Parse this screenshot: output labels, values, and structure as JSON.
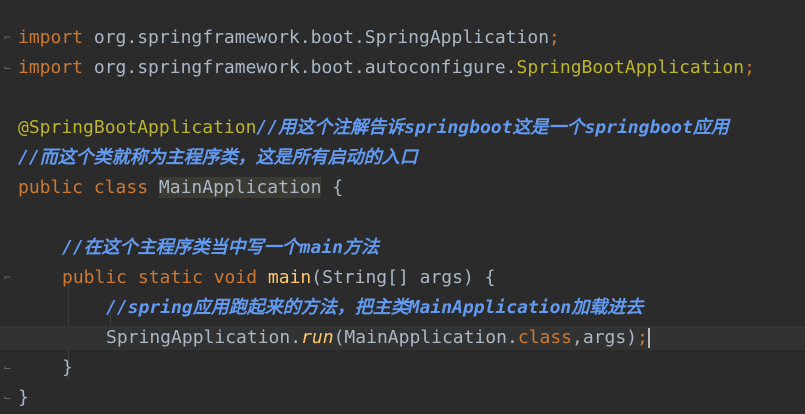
{
  "code": {
    "l1": {
      "kw": "import",
      "pkg": " org.springframework.boot.",
      "cls": "SpringApplication",
      "semi": ";"
    },
    "l2": {
      "kw": "import",
      "pkg": " org.springframework.boot.autoconfigure.",
      "cls": "SpringBootApplication",
      "semi": ";"
    },
    "l3": {
      "ann": "@SpringBootApplication",
      "cmt": "//用这个注解告诉springboot这是一个springboot应用"
    },
    "l4": {
      "cmt": "//而这个类就称为主程序类，这是所有启动的入口"
    },
    "l5": {
      "kw": "public class ",
      "cls": "MainApplication",
      "rest": " {"
    },
    "l6": {
      "cmt": "//在这个主程序类当中写一个main方法"
    },
    "l7": {
      "kw": "public static void ",
      "fn": "main",
      "rest": "(String[] args) {"
    },
    "l8": {
      "cmt": "//spring应用跑起来的方法，把主类MainApplication加载进去"
    },
    "l9": {
      "a": "SpringApplication.",
      "run": "run",
      "b": "(MainApplication.",
      "kw": "class",
      "c": ",args)",
      "semi": ";"
    },
    "l10": {
      "text": "}"
    },
    "l11": {
      "text": "}"
    }
  },
  "icons": [
    "fold-icon"
  ]
}
